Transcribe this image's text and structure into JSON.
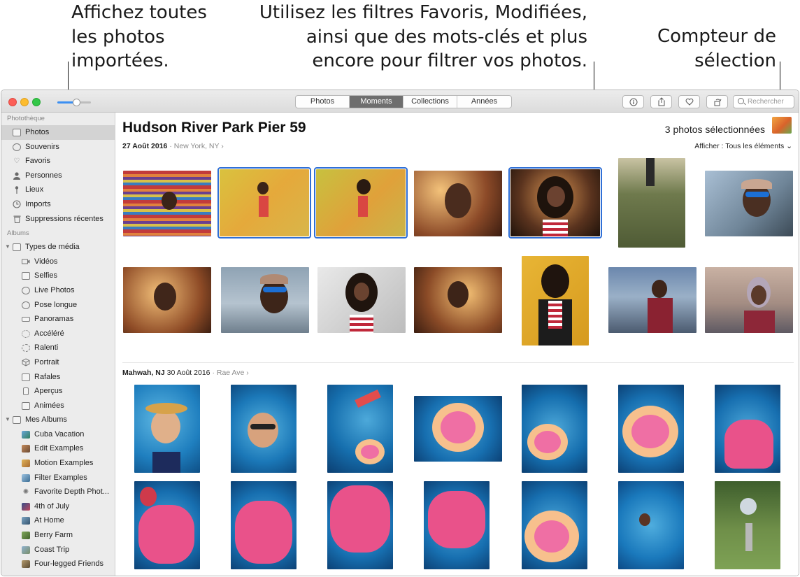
{
  "callouts": {
    "imports": "Affichez toutes\nles photos\nimportées.",
    "filters": "Utilisez les filtres Favoris, Modifiées,\nainsi que des mots-clés et plus\nencore pour filtrer vos photos.",
    "counter": "Compteur de\nsélection"
  },
  "toolbar": {
    "tabs": [
      "Photos",
      "Moments",
      "Collections",
      "Années"
    ],
    "active_tab": "Moments",
    "info_icon": "info-icon",
    "share_icon": "share-icon",
    "favorite_icon": "heart-icon",
    "rotate_icon": "rotate-icon",
    "search_placeholder": "Rechercher"
  },
  "sidebar": {
    "library_header": "Photothèque",
    "library_items": [
      {
        "label": "Photos",
        "icon": "photos-icon",
        "selected": true
      },
      {
        "label": "Souvenirs",
        "icon": "memories-icon"
      },
      {
        "label": "Favoris",
        "icon": "heart-icon"
      },
      {
        "label": "Personnes",
        "icon": "person-icon"
      },
      {
        "label": "Lieux",
        "icon": "pin-icon"
      },
      {
        "label": "Imports",
        "icon": "clock-icon"
      },
      {
        "label": "Suppressions récentes",
        "icon": "trash-icon"
      }
    ],
    "albums_header": "Albums",
    "media_types_label": "Types de média",
    "media_types": [
      {
        "label": "Vidéos",
        "icon": "video-icon"
      },
      {
        "label": "Selfies",
        "icon": "selfie-icon"
      },
      {
        "label": "Live Photos",
        "icon": "live-photo-icon"
      },
      {
        "label": "Pose longue",
        "icon": "long-exposure-icon"
      },
      {
        "label": "Panoramas",
        "icon": "panorama-icon"
      },
      {
        "label": "Accéléré",
        "icon": "timelapse-icon"
      },
      {
        "label": "Ralenti",
        "icon": "slomo-icon"
      },
      {
        "label": "Portrait",
        "icon": "portrait-icon"
      },
      {
        "label": "Rafales",
        "icon": "burst-icon"
      },
      {
        "label": "Aperçus",
        "icon": "screenshot-icon"
      },
      {
        "label": "Animées",
        "icon": "animated-icon"
      }
    ],
    "my_albums_label": "Mes Albums",
    "my_albums": [
      "Cuba Vacation",
      "Edit Examples",
      "Motion Examples",
      "Filter Examples",
      "Favorite Depth Phot...",
      "4th of July",
      "At Home",
      "Berry Farm",
      "Coast Trip",
      "Four-legged Friends"
    ]
  },
  "moment1": {
    "title": "Hudson River Park Pier 59",
    "date": "27 Août 2016",
    "location": "New York, NY",
    "selection_count": "3 photos sélectionnées",
    "filter_label": "Afficher :",
    "filter_value": "Tous les éléments"
  },
  "moment2": {
    "place": "Mahwah, NJ",
    "date": "30 Août 2016",
    "location": "Rae Ave"
  },
  "colors": {
    "selection_outline": "#2f6fd6",
    "active_tab": "#6e6e6e"
  }
}
